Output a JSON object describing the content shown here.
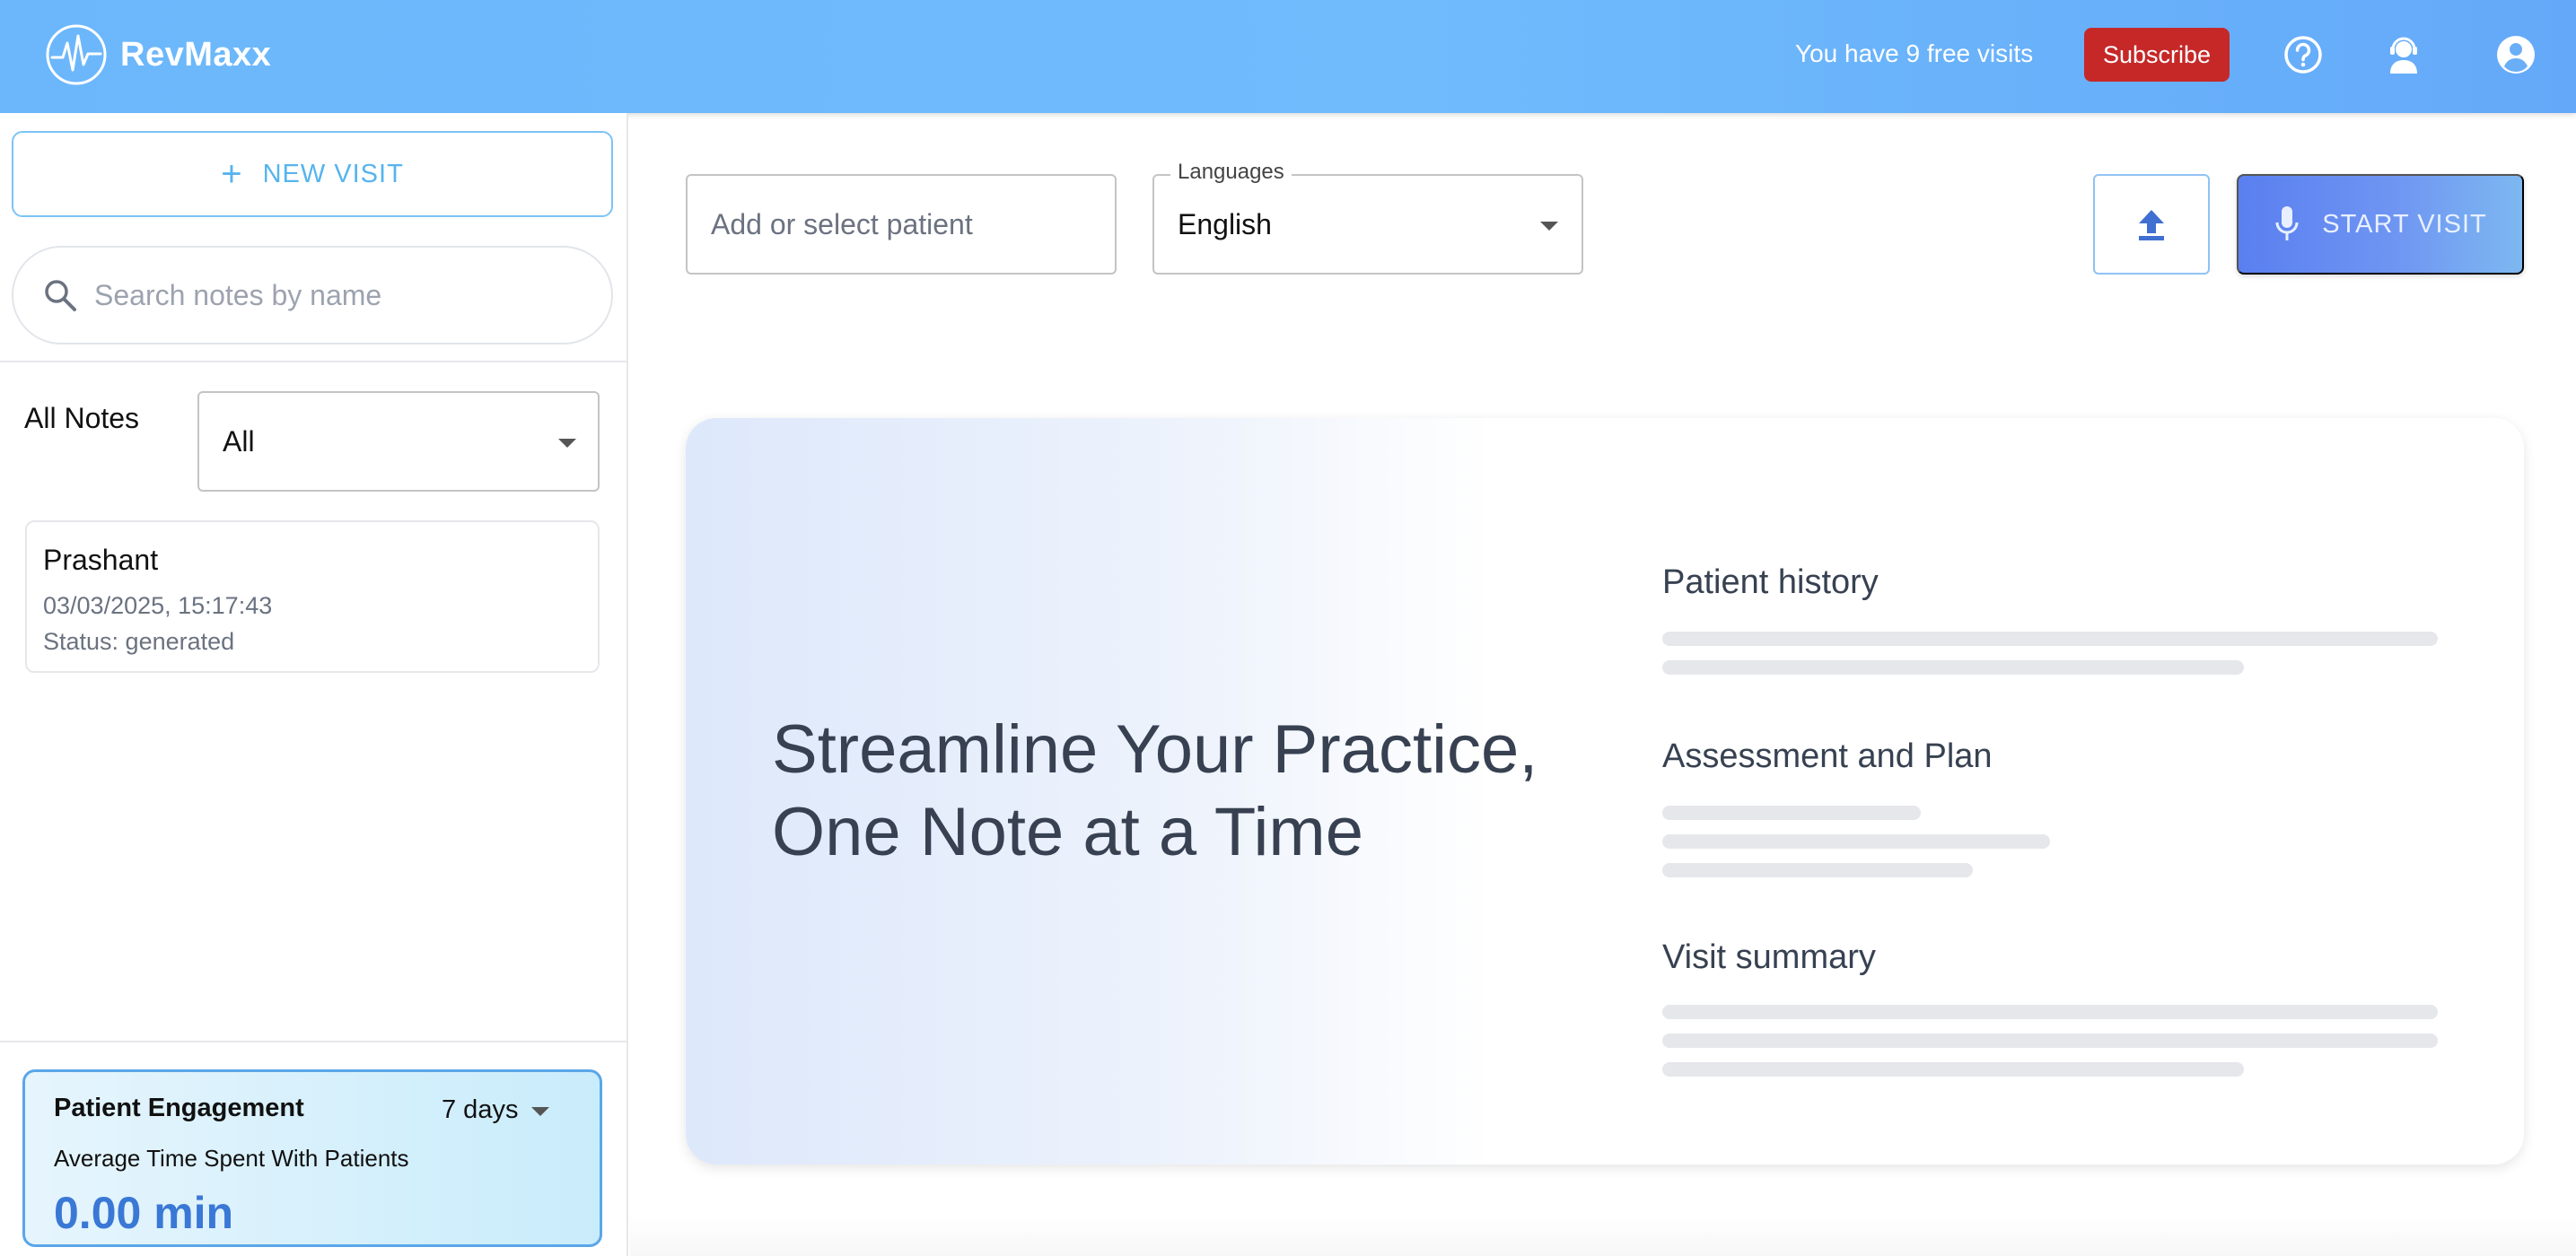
{
  "header": {
    "brand": "RevMaxx",
    "free_visits_text": "You have 9 free visits",
    "subscribe_label": "Subscribe",
    "icons": [
      "help-circle-icon",
      "support-agent-icon",
      "account-circle-icon"
    ]
  },
  "sidebar": {
    "new_visit_label": "NEW VISIT",
    "search_placeholder": "Search notes by name",
    "filter_label": "All Notes",
    "filter_value": "All",
    "notes": [
      {
        "name": "Prashant",
        "datetime": "03/03/2025, 15:17:43",
        "status": "Status: generated"
      }
    ],
    "engagement": {
      "title": "Patient Engagement",
      "range": "7 days",
      "subtitle": "Average Time Spent With Patients",
      "value": "0.00 min"
    }
  },
  "main": {
    "patient_placeholder": "Add or select patient",
    "language_label": "Languages",
    "language_value": "English",
    "start_visit_label": "START VISIT",
    "hero": {
      "title": "Streamline Your Practice, One Note at a Time",
      "sections": [
        "Patient history",
        "Assessment and Plan",
        "Visit summary"
      ]
    }
  },
  "colors": {
    "header_gradient_start": "#6cb7fb",
    "subscribe": "#c62828",
    "accent_blue": "#3a78d6",
    "start_visit_gradient": "#5a7ff0"
  }
}
